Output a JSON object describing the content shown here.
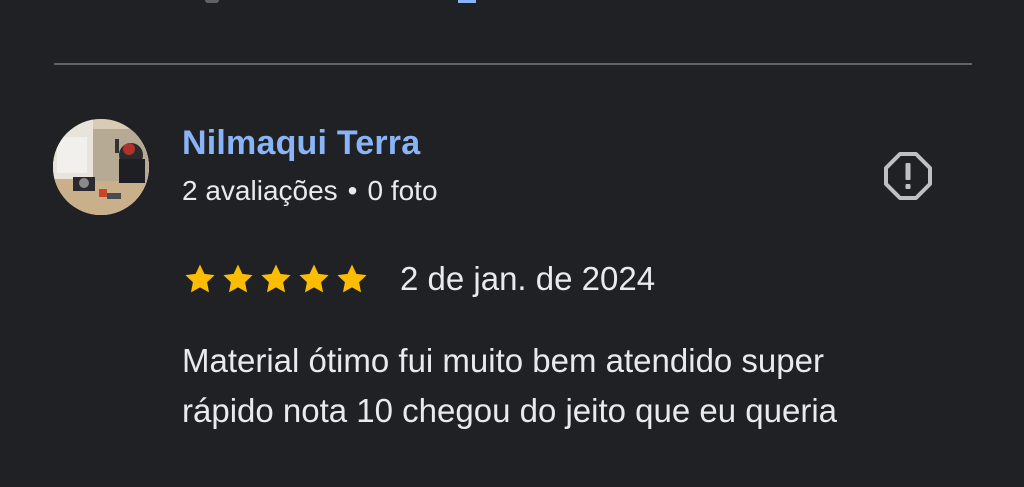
{
  "review": {
    "reviewer_name": "Nilmaqui Terra",
    "reviews_count": "2 avaliações",
    "separator": "•",
    "photos_count": "0 foto",
    "rating": 5,
    "rating_max": 5,
    "date": "2 de jan. de 2024",
    "text_line1": "Material ótimo fui muito bem atendido super",
    "text_line2": "rápido nota 10 chegou do jeito que eu queria"
  },
  "icons": {
    "report": "report-octagon-icon",
    "star": "star-icon"
  },
  "colors": {
    "background": "#202124",
    "name": "#8ab4f8",
    "text": "#e8eaed",
    "star": "#fbbc04",
    "divider": "#5f6368",
    "icon": "#bdc1c6"
  }
}
